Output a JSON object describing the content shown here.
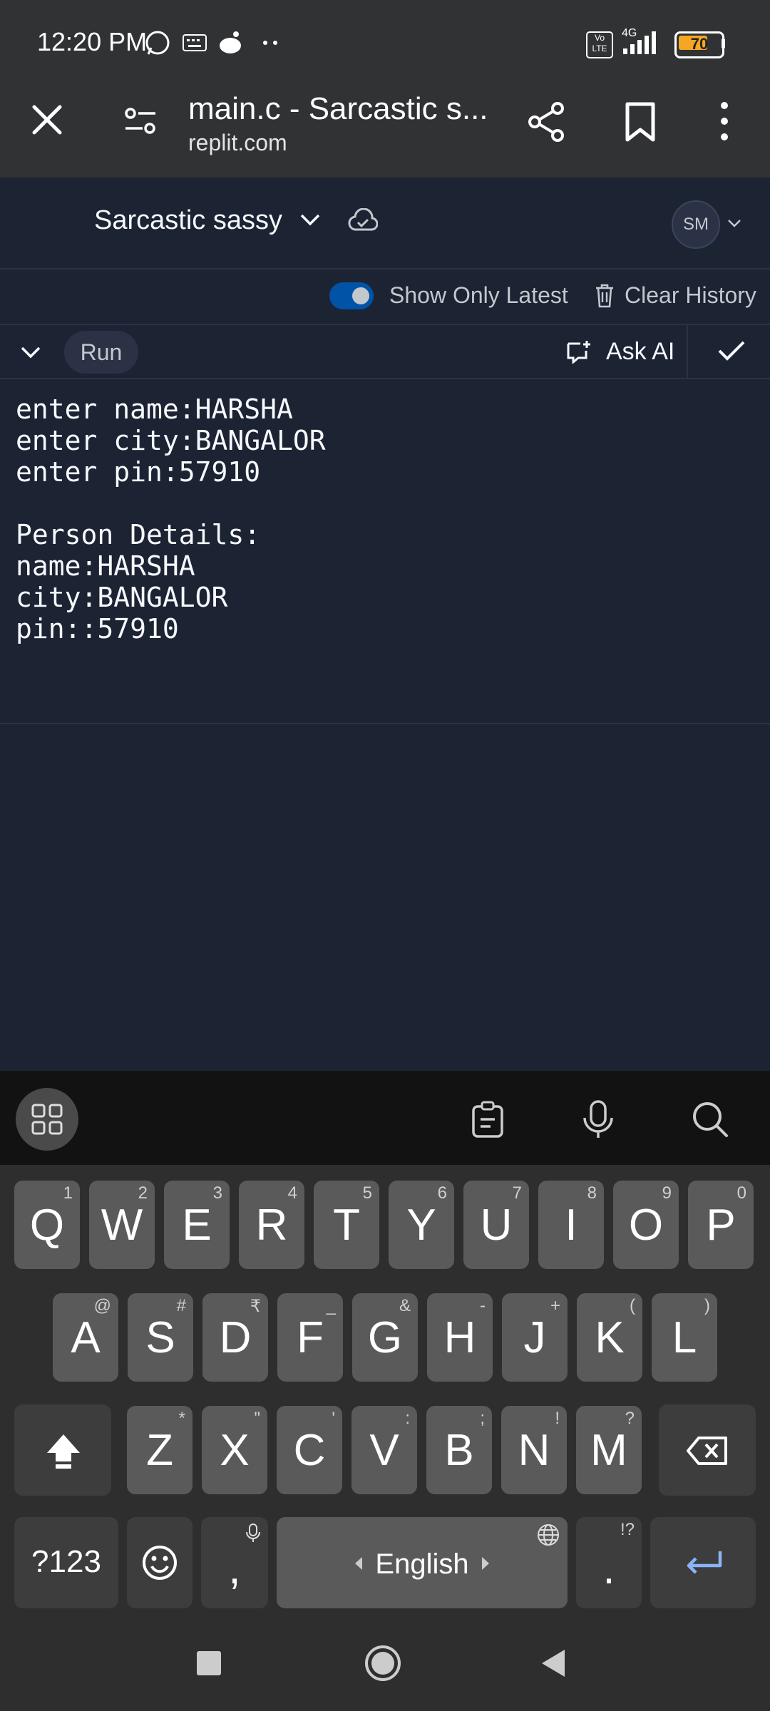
{
  "status_bar": {
    "time": "12:20 PM",
    "network": "4G",
    "volte": "Vo LTE",
    "battery": "70"
  },
  "browser": {
    "title": "main.c - Sarcastic s...",
    "url": "replit.com"
  },
  "app": {
    "repl_name": "Sarcastic sassy",
    "avatar_initials": "SM",
    "show_only_latest_label": "Show Only Latest",
    "show_only_latest_on": true,
    "clear_history_label": "Clear History",
    "run_label": "Run",
    "ask_ai_label": "Ask AI"
  },
  "console": {
    "lines": [
      "enter name:HARSHA",
      "enter city:BANGALOR",
      "enter pin:57910",
      "",
      "Person Details:",
      "name:HARSHA",
      "city:BANGALOR",
      "pin::57910"
    ]
  },
  "keyboard": {
    "row1": [
      {
        "key": "Q",
        "hint": "1"
      },
      {
        "key": "W",
        "hint": "2"
      },
      {
        "key": "E",
        "hint": "3"
      },
      {
        "key": "R",
        "hint": "4"
      },
      {
        "key": "T",
        "hint": "5"
      },
      {
        "key": "Y",
        "hint": "6"
      },
      {
        "key": "U",
        "hint": "7"
      },
      {
        "key": "I",
        "hint": "8"
      },
      {
        "key": "O",
        "hint": "9"
      },
      {
        "key": "P",
        "hint": "0"
      }
    ],
    "row2": [
      {
        "key": "A",
        "hint": "@"
      },
      {
        "key": "S",
        "hint": "#"
      },
      {
        "key": "D",
        "hint": "₹"
      },
      {
        "key": "F",
        "hint": "_"
      },
      {
        "key": "G",
        "hint": "&"
      },
      {
        "key": "H",
        "hint": "-"
      },
      {
        "key": "J",
        "hint": "+"
      },
      {
        "key": "K",
        "hint": "("
      },
      {
        "key": "L",
        "hint": ")"
      }
    ],
    "row3": [
      {
        "key": "Z",
        "hint": "*"
      },
      {
        "key": "X",
        "hint": "\""
      },
      {
        "key": "C",
        "hint": "'"
      },
      {
        "key": "V",
        "hint": ":"
      },
      {
        "key": "B",
        "hint": ";"
      },
      {
        "key": "N",
        "hint": "!"
      },
      {
        "key": "M",
        "hint": "?"
      }
    ],
    "symbols_label": "?123",
    "comma": ",",
    "space_label": "English",
    "period": ".",
    "period_hint": "!?"
  }
}
